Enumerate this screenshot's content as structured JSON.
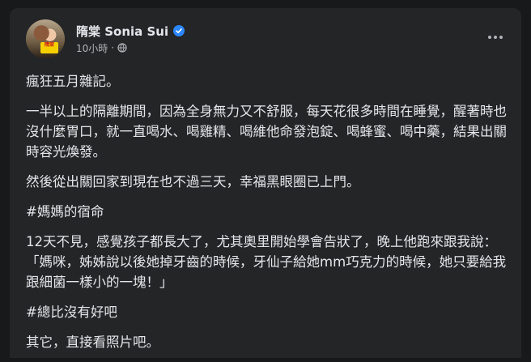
{
  "post": {
    "author": "隋棠 Sonia Sui",
    "timestamp": "10小時",
    "separator": "·",
    "paragraphs": [
      "瘋狂五月雜記。",
      "一半以上的隔離期間，因為全身無力又不舒服，每天花很多時間在睡覺，醒著時也沒什麼胃口，就一直喝水、喝雞精、喝維他命發泡錠、喝蜂蜜、喝中藥，結果出關時容光煥發。",
      "然後從出關回家到現在也不過三天，幸福黑眼圈已上門。",
      "#媽媽的宿命",
      "12天不見，感覺孩子都長大了，尤其奧里開始學會告狀了，晚上他跑來跟我說：「媽咪，姊姊說以後她掉牙齒的時候，牙仙子給她mm巧克力的時候，她只要給我跟細菌一樣小的一塊！」",
      "#總比沒有好吧",
      "其它，直接看照片吧。"
    ],
    "avatar_badge": "隋棠"
  },
  "icons": {
    "verified": "verified-badge-icon",
    "audience": "globe-icon",
    "more": "more-options-icon"
  },
  "colors": {
    "background": "#18191a",
    "card": "#242526",
    "text": "#e4e6eb",
    "secondary_text": "#b0b3b8",
    "verified_blue": "#2d88ff"
  }
}
